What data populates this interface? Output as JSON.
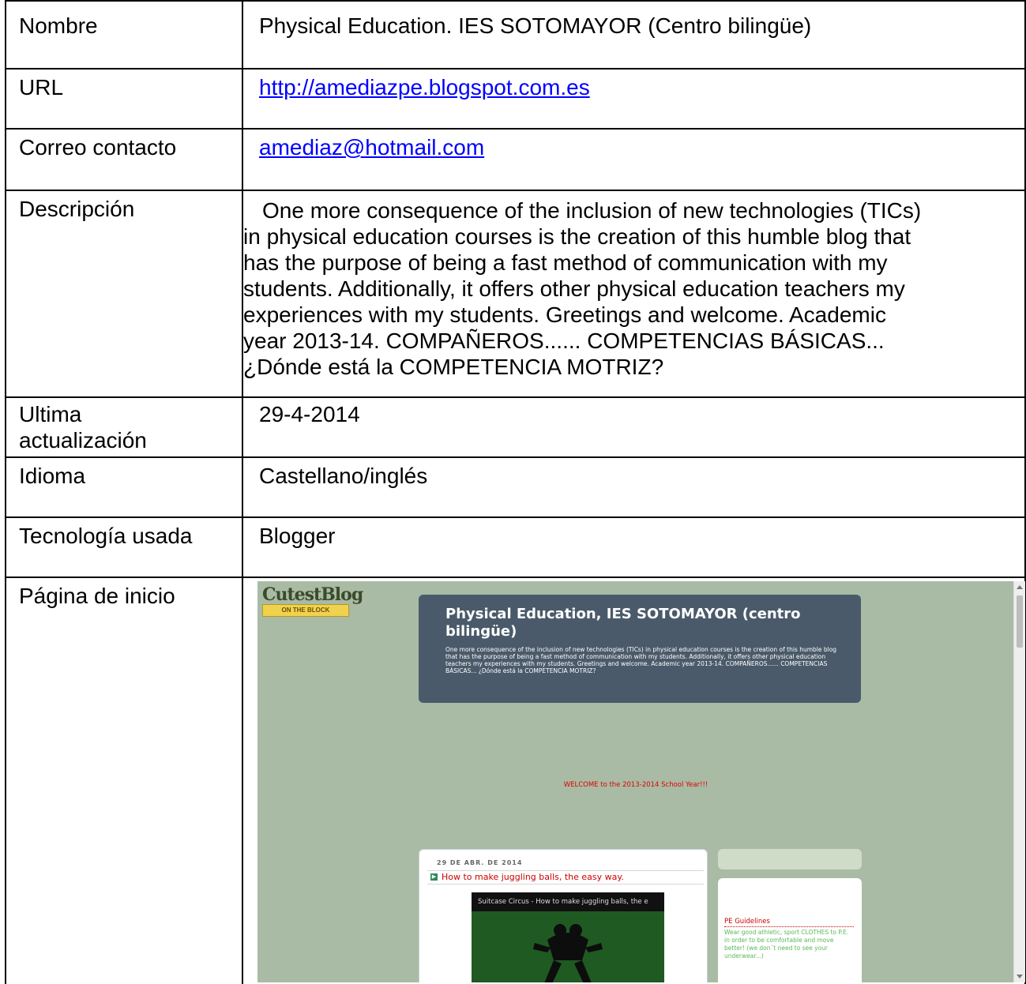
{
  "rows": {
    "nombre": {
      "label": "Nombre",
      "value": "Physical Education. IES SOTOMAYOR (Centro bilingüe)"
    },
    "url": {
      "label": "URL",
      "value": "http://amediazpe.blogspot.com.es"
    },
    "correo": {
      "label": "Correo contacto",
      "value": "amediaz@hotmail.com"
    },
    "descripcion": {
      "label": "Descripción",
      "lines": [
        "One more consequence of the inclusion of new technologies (TICs)",
        "in physical education courses is the creation of this humble blog that",
        "has the purpose of being a fast method of communication with my",
        "students. Additionally, it offers other physical education teachers my",
        "experiences with my students. Greetings and welcome. Academic",
        "year 2013-14. COMPAÑEROS...... COMPETENCIAS BÁSICAS...",
        "¿Dónde está la COMPETENCIA MOTRIZ?"
      ]
    },
    "ultima": {
      "label_line1": "Ultima",
      "label_line2": "actualización",
      "value": "29-4-2014"
    },
    "idioma": {
      "label": "Idioma",
      "value": "Castellano/inglés"
    },
    "tecnologia": {
      "label": "Tecnología usada",
      "value": "Blogger"
    },
    "pagina": {
      "label": "Página de inicio"
    }
  },
  "screenshot": {
    "logo_text": "CutestBlog",
    "logo_ribbon": "ON THE BLOCK",
    "blog_title_line1": "Physical Education, IES SOTOMAYOR (centro",
    "blog_title_line2": "bilingüe)",
    "blog_description": "One more consequence of the inclusion of new technologies (TICs) in physical education courses is the creation of this humble blog that has the purpose of being a fast method of communication with my students. Additionally, it offers other physical education teachers my experiences with my students. Greetings and welcome. Academic year 2013-14. COMPAÑEROS...... COMPETENCIAS BÁSICAS... ¿Dónde está la COMPETENCIA MOTRIZ?",
    "welcome": "WELCOME to the 2013-2014 School Year!!!",
    "post_date": "29 DE ABR. DE 2014",
    "post_title": "How to make juggling balls, the easy way.",
    "video_title": "Suitcase Circus - How to make juggling balls, the e",
    "sidebar_title": "PE Guidelines",
    "sidebar_text": "Wear good athletic, sport CLOTHES to P.E. in order to be comfortable and move better! (we don´t need to see your underwear...)",
    "colors": {
      "background": "#a9bba4",
      "header": "#4a5a6a",
      "welcome": "#e00000",
      "post_title": "#cc0000",
      "sidebar_text": "#5bb85b"
    }
  }
}
